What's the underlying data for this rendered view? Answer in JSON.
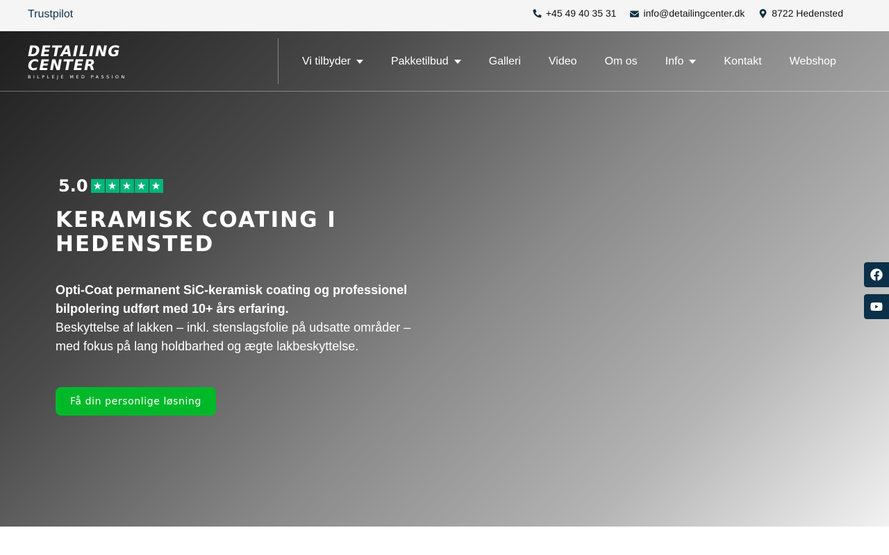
{
  "topbar": {
    "trustpilot_label": "Trustpilot",
    "phone": "+45 49 40 35 31",
    "email": "info@detailingcenter.dk",
    "location": "8722 Hedensted",
    "phone_icon": "phone-icon",
    "email_icon": "envelope-icon",
    "location_icon": "map-pin-icon"
  },
  "logo": {
    "line1": "DETAILING",
    "line2": "CENTER",
    "tagline": "BILPLEJE MED PASSION"
  },
  "nav": {
    "items": [
      {
        "label": "Vi tilbyder",
        "has_dropdown": true
      },
      {
        "label": "Pakketilbud",
        "has_dropdown": true
      },
      {
        "label": "Galleri",
        "has_dropdown": false
      },
      {
        "label": "Video",
        "has_dropdown": false
      },
      {
        "label": "Om os",
        "has_dropdown": false
      },
      {
        "label": "Info",
        "has_dropdown": true
      },
      {
        "label": "Kontakt",
        "has_dropdown": false
      },
      {
        "label": "Webshop",
        "has_dropdown": false
      }
    ]
  },
  "hero": {
    "rating_score": "5.0",
    "rating_stars": 5,
    "title": "KERAMISK COATING I HEDENSTED",
    "lead_bold": "Opti-Coat permanent SiC-keramisk coating og professionel bilpolering udført med 10+ års erfaring.",
    "lead_text": "Beskyttelse af lakken – inkl. stenslagsfolie på udsatte områder – med fokus på lang holdbarhed og ægte lakbeskyttelse.",
    "cta_label": "Få din personlige løsning"
  },
  "social": {
    "facebook_icon": "facebook-icon",
    "youtube_icon": "youtube-icon"
  },
  "colors": {
    "topbar_bg": "#f5f5f5",
    "accent_green": "#00b929",
    "trustpilot_green": "#00b67a",
    "social_bg": "#0b3049",
    "link_dark": "#0f3146"
  }
}
